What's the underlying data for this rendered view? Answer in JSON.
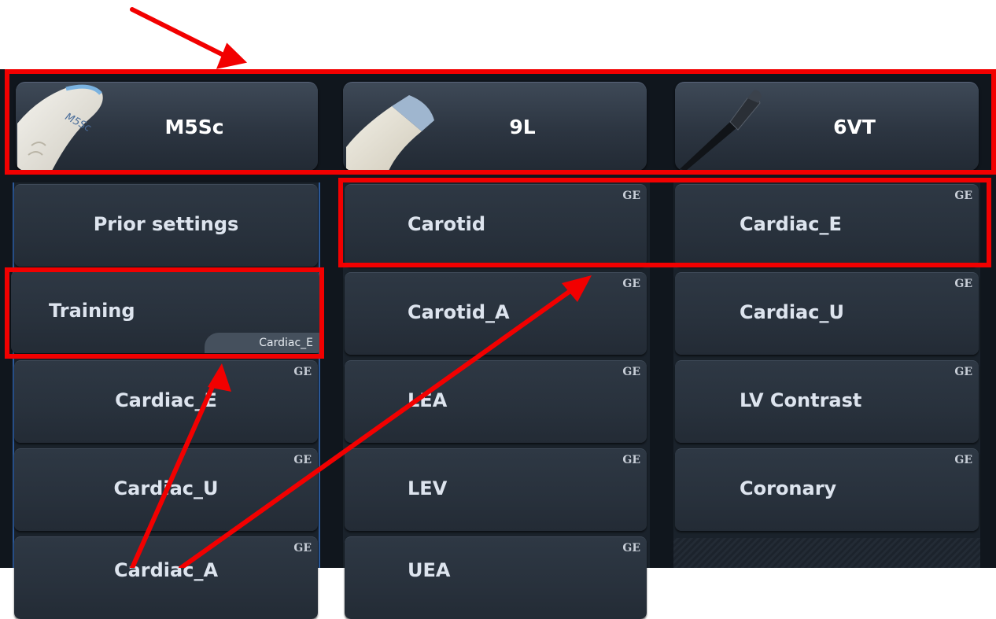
{
  "probes": [
    {
      "name": "M5Sc",
      "image_label": "M5Sc"
    },
    {
      "name": "9L"
    },
    {
      "name": "6VT"
    }
  ],
  "col1": {
    "prior": "Prior settings",
    "training": "Training",
    "training_tag": "Cardiac_E",
    "items": [
      "Cardiac_E",
      "Cardiac_U",
      "Cardiac_A"
    ]
  },
  "col2": {
    "items": [
      "Carotid",
      "Carotid_A",
      "LEA",
      "LEV",
      "UEA"
    ]
  },
  "col3": {
    "items": [
      "Cardiac_E",
      "Cardiac_U",
      "LV Contrast",
      "Coronary"
    ]
  },
  "badge": "GE",
  "colors": {
    "highlight": "#f20000",
    "background": "#10161d",
    "tile": "#2a333e"
  },
  "icons": [
    "m5sc-probe-icon",
    "9l-probe-icon",
    "6vt-probe-icon"
  ]
}
